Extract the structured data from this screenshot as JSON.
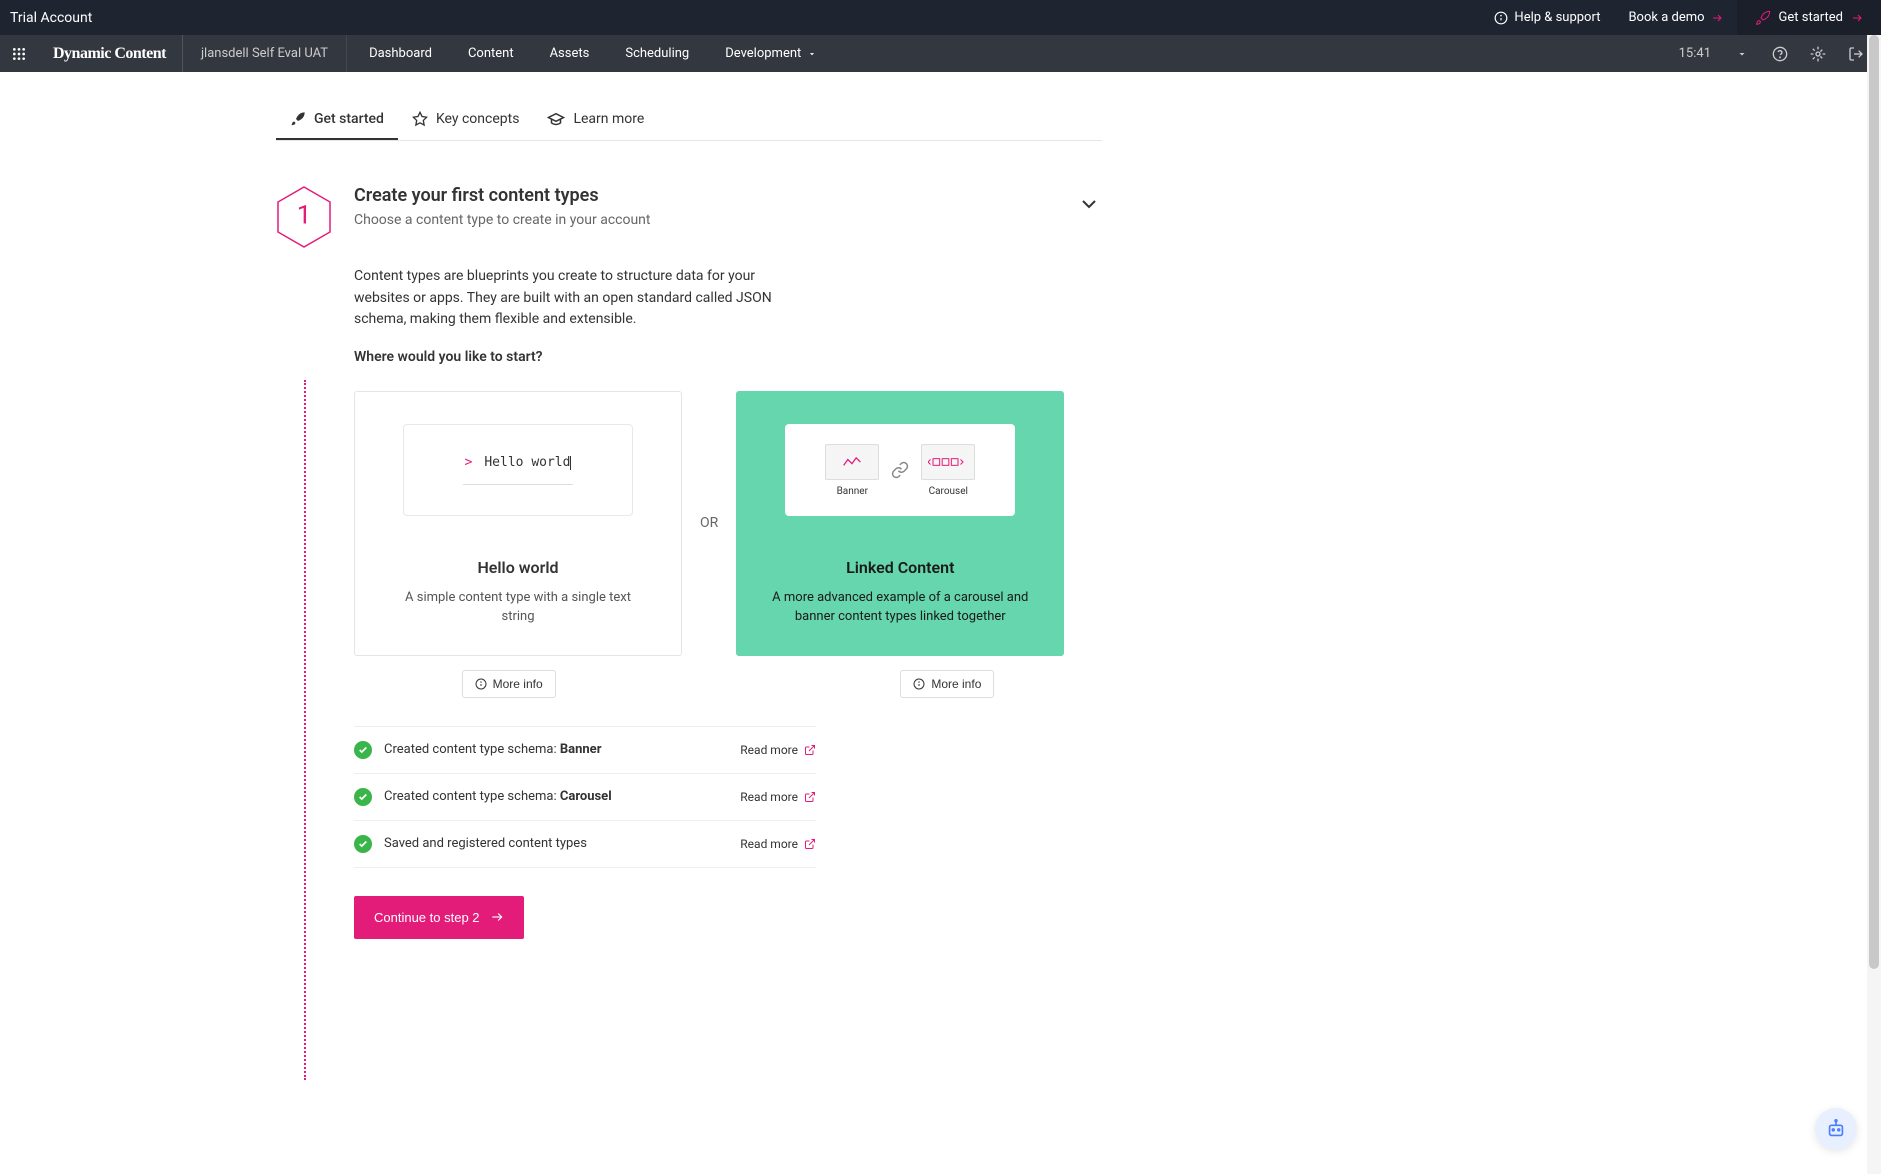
{
  "top_bar": {
    "account_label": "Trial Account",
    "help_label": "Help & support",
    "demo_label": "Book a demo",
    "get_started_label": "Get started"
  },
  "main_nav": {
    "brand": "Dynamic Content",
    "account_name": "jlansdell Self Eval UAT",
    "items": [
      "Dashboard",
      "Content",
      "Assets",
      "Scheduling",
      "Development"
    ],
    "time": "15:41"
  },
  "sub_tabs": {
    "get_started": "Get started",
    "key_concepts": "Key concepts",
    "learn_more": "Learn more"
  },
  "step": {
    "number": "1",
    "title": "Create your first content types",
    "subtitle": "Choose a content type to create in your account",
    "description": "Content types are blueprints you create to structure data for your websites or apps. They are built with an open standard called JSON schema, making them flexible and extensible.",
    "prompt": "Where would you like to start?"
  },
  "or_label": "OR",
  "cards": {
    "hello": {
      "code_prompt": ">",
      "code_text": "Hello world",
      "title": "Hello world",
      "desc": "A simple content type with a single text string"
    },
    "linked": {
      "banner_label": "Banner",
      "carousel_label": "Carousel",
      "title": "Linked Content",
      "desc": "A more advanced example of a carousel and banner content types linked together"
    },
    "more_info": "More info"
  },
  "checklist": [
    {
      "prefix": "Created content type schema: ",
      "bold": "Banner",
      "link": "Read more"
    },
    {
      "prefix": "Created content type schema: ",
      "bold": "Carousel",
      "link": "Read more"
    },
    {
      "prefix": "Saved and registered content types",
      "bold": "",
      "link": "Read more"
    }
  ],
  "continue_label": "Continue to step 2"
}
